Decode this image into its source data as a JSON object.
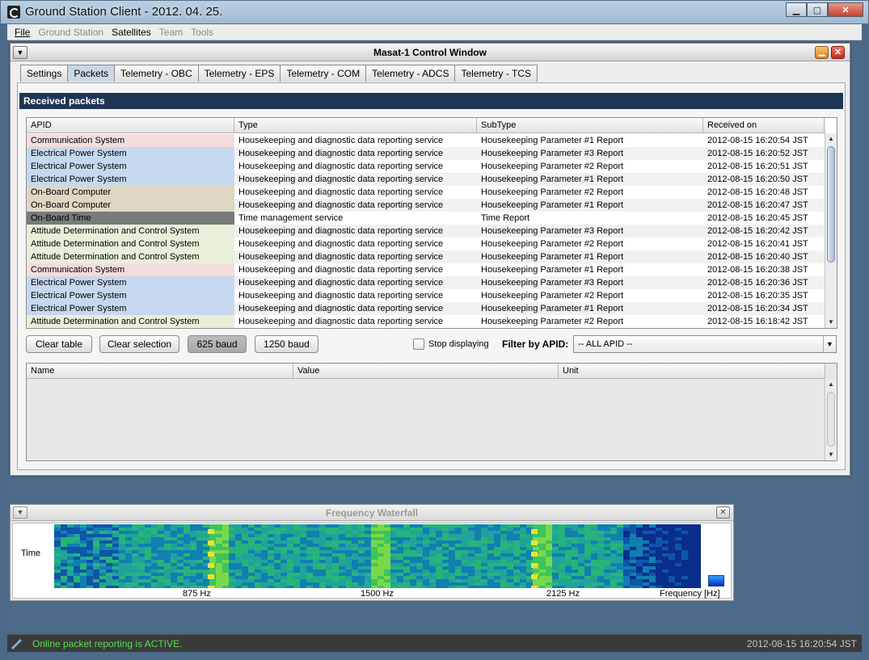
{
  "os_window": {
    "title": "Ground Station Client - 2012. 04. 25.",
    "min_label": "▁",
    "max_label": "▢",
    "close_label": "✕"
  },
  "menubar": {
    "file": "File",
    "ground_station": "Ground Station",
    "satellites": "Satellites",
    "team": "Team",
    "tools": "Tools"
  },
  "control_window": {
    "title": "Masat-1 Control Window",
    "tabs": [
      "Settings",
      "Packets",
      "Telemetry - OBC",
      "Telemetry - EPS",
      "Telemetry - COM",
      "Telemetry - ADCS",
      "Telemetry - TCS"
    ],
    "active_tab": "Packets",
    "section_title": "Received packets",
    "packets_table": {
      "columns": [
        "APID",
        "Type",
        "SubType",
        "Received on"
      ],
      "rows": [
        {
          "apid": "Communication System",
          "type": "Housekeeping and diagnostic data reporting service",
          "subtype": "Housekeeping Parameter #1 Report",
          "received": "2012-08-15 16:20:54 JST"
        },
        {
          "apid": "Electrical Power System",
          "type": "Housekeeping and diagnostic data reporting service",
          "subtype": "Housekeeping Parameter #3 Report",
          "received": "2012-08-15 16:20:52 JST"
        },
        {
          "apid": "Electrical Power System",
          "type": "Housekeeping and diagnostic data reporting service",
          "subtype": "Housekeeping Parameter #2 Report",
          "received": "2012-08-15 16:20:51 JST"
        },
        {
          "apid": "Electrical Power System",
          "type": "Housekeeping and diagnostic data reporting service",
          "subtype": "Housekeeping Parameter #1 Report",
          "received": "2012-08-15 16:20:50 JST"
        },
        {
          "apid": "On-Board Computer",
          "type": "Housekeeping and diagnostic data reporting service",
          "subtype": "Housekeeping Parameter #2 Report",
          "received": "2012-08-15 16:20:48 JST"
        },
        {
          "apid": "On-Board Computer",
          "type": "Housekeeping and diagnostic data reporting service",
          "subtype": "Housekeeping Parameter #1 Report",
          "received": "2012-08-15 16:20:47 JST"
        },
        {
          "apid": "On-Board Time",
          "type": "Time management service",
          "subtype": "Time Report",
          "received": "2012-08-15 16:20:45 JST"
        },
        {
          "apid": "Attitude Determination and Control System",
          "type": "Housekeeping and diagnostic data reporting service",
          "subtype": "Housekeeping Parameter #3 Report",
          "received": "2012-08-15 16:20:42 JST"
        },
        {
          "apid": "Attitude Determination and Control System",
          "type": "Housekeeping and diagnostic data reporting service",
          "subtype": "Housekeeping Parameter #2 Report",
          "received": "2012-08-15 16:20:41 JST"
        },
        {
          "apid": "Attitude Determination and Control System",
          "type": "Housekeeping and diagnostic data reporting service",
          "subtype": "Housekeeping Parameter #1 Report",
          "received": "2012-08-15 16:20:40 JST"
        },
        {
          "apid": "Communication System",
          "type": "Housekeeping and diagnostic data reporting service",
          "subtype": "Housekeeping Parameter #1 Report",
          "received": "2012-08-15 16:20:38 JST"
        },
        {
          "apid": "Electrical Power System",
          "type": "Housekeeping and diagnostic data reporting service",
          "subtype": "Housekeeping Parameter #3 Report",
          "received": "2012-08-15 16:20:36 JST"
        },
        {
          "apid": "Electrical Power System",
          "type": "Housekeeping and diagnostic data reporting service",
          "subtype": "Housekeeping Parameter #2 Report",
          "received": "2012-08-15 16:20:35 JST"
        },
        {
          "apid": "Electrical Power System",
          "type": "Housekeeping and diagnostic data reporting service",
          "subtype": "Housekeeping Parameter #1 Report",
          "received": "2012-08-15 16:20:34 JST"
        },
        {
          "apid": "Attitude Determination and Control System",
          "type": "Housekeeping and diagnostic data reporting service",
          "subtype": "Housekeeping Parameter #2 Report",
          "received": "2012-08-15 16:18:42 JST"
        }
      ]
    },
    "apid_colors": {
      "Communication System": "#f5dcdc",
      "Electrical Power System": "#c6d8ef",
      "On-Board Computer": "#ded7c3",
      "On-Board Time": "#7a7a7a",
      "Attitude Determination and Control System": "#e8efd9"
    },
    "controls": {
      "clear_table": "Clear table",
      "clear_selection": "Clear selection",
      "baud_625": "625 baud",
      "baud_1250": "1250 baud",
      "active_baud": "625 baud",
      "stop_displaying": "Stop displaying",
      "stop_displaying_checked": false,
      "filter_label": "Filter by APID:",
      "filter_value": "-- ALL APID --"
    },
    "params_table": {
      "columns": [
        "Name",
        "Value",
        "Unit"
      ]
    }
  },
  "waterfall": {
    "title": "Frequency Waterfall",
    "y_label": "Time",
    "x_label": "Frequency [Hz]",
    "ticks": [
      "875 Hz",
      "1500 Hz",
      "2125 Hz"
    ]
  },
  "statusbar": {
    "message": "Online packet reporting is ACTIVE.",
    "timestamp": "2012-08-15 16:20:54 JST",
    "message_color": "#53e04c"
  }
}
